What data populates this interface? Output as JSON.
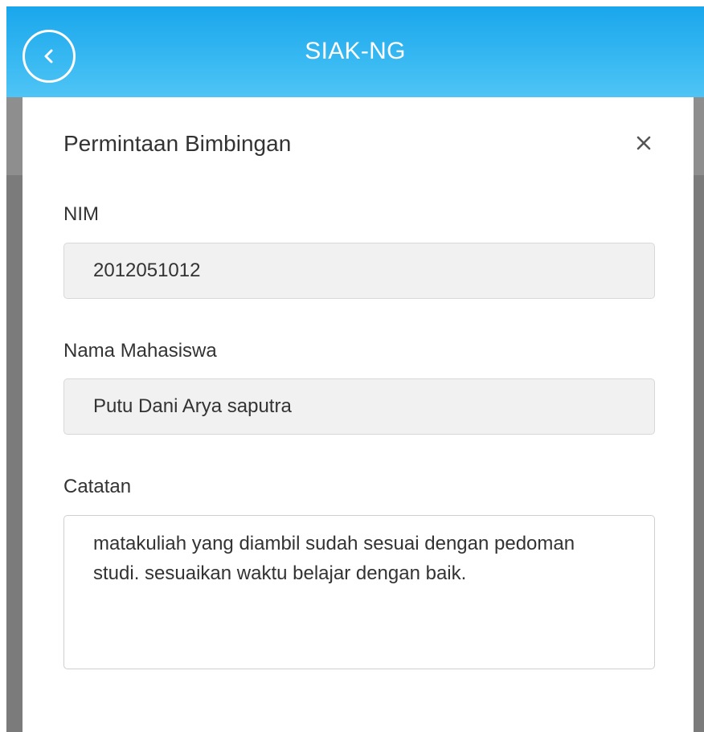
{
  "appbar": {
    "title": "SIAK-NG",
    "back_icon": "chevron-left-circle-icon",
    "color": "#29b1ef"
  },
  "modal": {
    "title": "Permintaan Bimbingan",
    "close_icon": "close-icon",
    "fields": {
      "nim": {
        "label": "NIM",
        "value": "2012051012"
      },
      "nama": {
        "label": "Nama Mahasiswa",
        "value": "Putu Dani Arya saputra"
      },
      "catatan": {
        "label": "Catatan",
        "value": "matakuliah yang diambil sudah sesuai dengan pedoman studi. sesuaikan waktu belajar dengan baik."
      }
    }
  }
}
